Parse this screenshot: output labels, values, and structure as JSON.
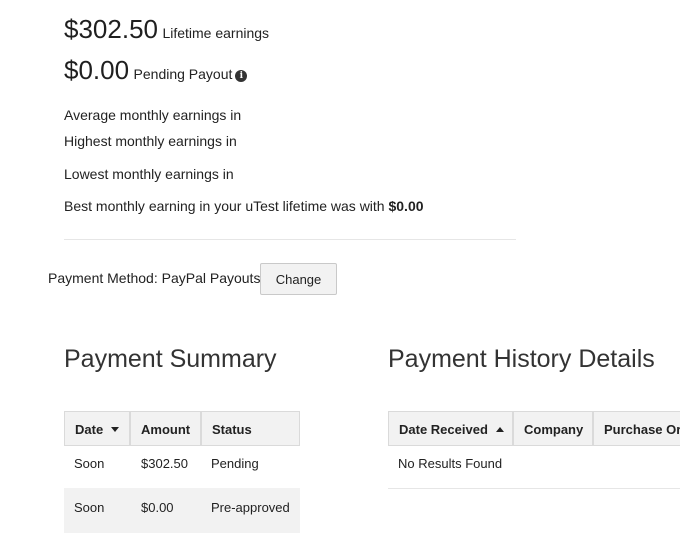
{
  "earnings": {
    "lifetime_amount": "$302.50",
    "lifetime_label": "Lifetime earnings",
    "pending_amount": "$0.00",
    "pending_label": "Pending Payout",
    "average_label": "Average monthly earnings in",
    "highest_label": "Highest monthly earnings in",
    "lowest_label": "Lowest monthly earnings in",
    "best_prefix": "Best monthly earning in your uTest lifetime was with",
    "best_value": "$0.00"
  },
  "payment_method": {
    "label": "Payment Method: PayPal Payouts",
    "change_button": "Change"
  },
  "payment_summary": {
    "title": "Payment Summary",
    "columns": [
      "Date",
      "Amount",
      "Status"
    ],
    "rows": [
      {
        "date": "Soon",
        "amount": "$302.50",
        "status": "Pending"
      },
      {
        "date": "Soon",
        "amount": "$0.00",
        "status": "Pre-approved"
      }
    ]
  },
  "payment_history": {
    "title": "Payment History Details",
    "columns": [
      "Date Received",
      "Company",
      "Purchase Or"
    ],
    "empty_message": "No Results Found"
  }
}
